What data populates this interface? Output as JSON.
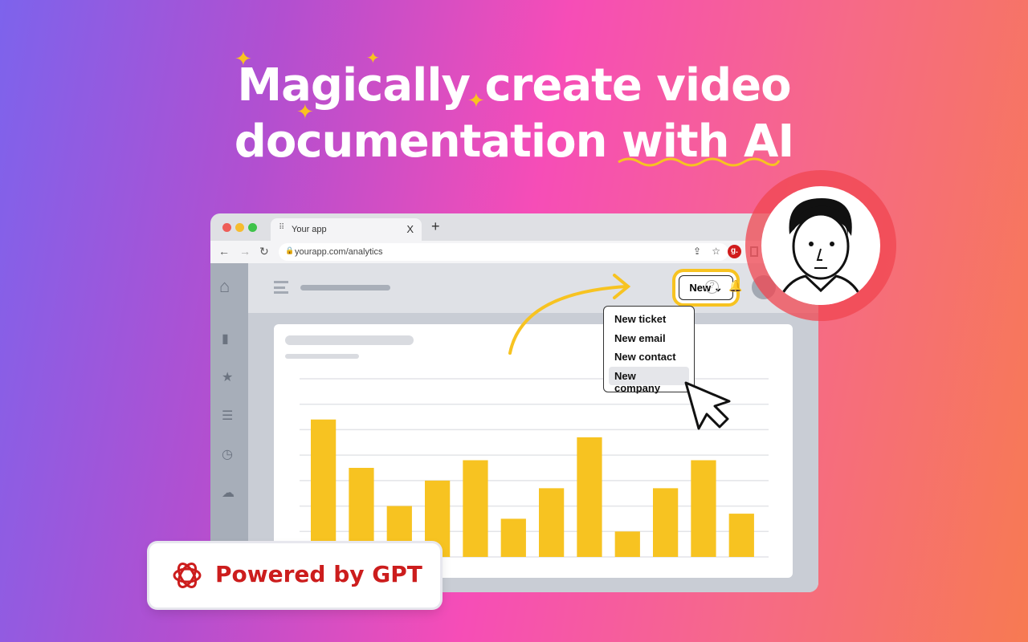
{
  "headline": {
    "line1": "Magically create video",
    "line2_a": "documentation ",
    "line2_b": "with AI"
  },
  "colors": {
    "accent": "#f7c321",
    "gpt_red": "#cc1d1d",
    "avatar_ring": "#ef4c5a"
  },
  "browser": {
    "tab_title": "Your app",
    "tab_close": "X",
    "new_tab": "+",
    "url": "yourapp.com/analytics",
    "extension_badge": "g."
  },
  "app": {
    "new_button": "New",
    "menu_items": [
      "New ticket",
      "New email",
      "New contact",
      "New company"
    ],
    "selected_item": "New company"
  },
  "badge": {
    "label": "Powered by GPT"
  },
  "chart_data": {
    "type": "bar",
    "values": [
      5.4,
      3.5,
      2.0,
      3.0,
      3.8,
      1.5,
      2.7,
      4.7,
      1.0,
      2.7,
      3.8,
      1.7
    ],
    "ylim": [
      0,
      7
    ],
    "grid": true
  }
}
